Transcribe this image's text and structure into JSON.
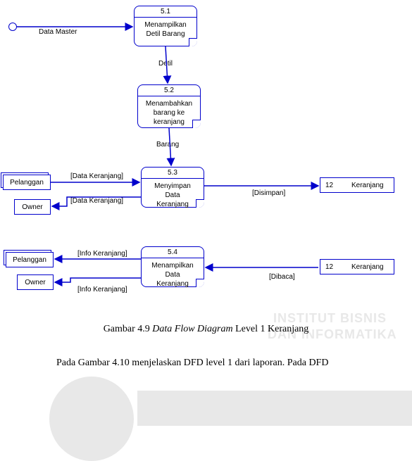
{
  "processes": {
    "p51": {
      "id": "5.1",
      "name": "Menampilkan\nDetil Barang"
    },
    "p52": {
      "id": "5.2",
      "name": "Menambahkan\nbarang ke\nkeranjang"
    },
    "p53": {
      "id": "5.3",
      "name": "Menyimpan\nData\nKeranjang"
    },
    "p54": {
      "id": "5.4",
      "name": "Menampilkan\nData\nKeranjang"
    }
  },
  "entities": {
    "pelanggan1": "Pelanggan",
    "owner1": "Owner",
    "pelanggan2": "Pelanggan",
    "owner2": "Owner"
  },
  "datastores": {
    "ds1": {
      "id": "12",
      "name": "Keranjang"
    },
    "ds2": {
      "id": "12",
      "name": "Keranjang"
    }
  },
  "flows": {
    "f_master": "Data Master",
    "f_detil": "Detil",
    "f_barang": "Barang",
    "f_dk1": "[Data Keranjang]",
    "f_dk2": "[Data Keranjang]",
    "f_disimpan": "[Disimpan]",
    "f_ik1": "[Info Keranjang]",
    "f_ik2": "[Info Keranjang]",
    "f_dibaca": "[Dibaca]"
  },
  "caption": {
    "prefix": "Gambar 4.9 ",
    "italic": "Data Flow Diagram",
    "suffix": " Level 1 Keranjang"
  },
  "bodytext": "Pada  Gambar  4.10  menjelaskan  DFD  level  1  dari  laporan.  Pada  DFD",
  "watermark": {
    "line1": "INSTITUT BISNIS",
    "line2": "DAN INFORMATIKA"
  }
}
